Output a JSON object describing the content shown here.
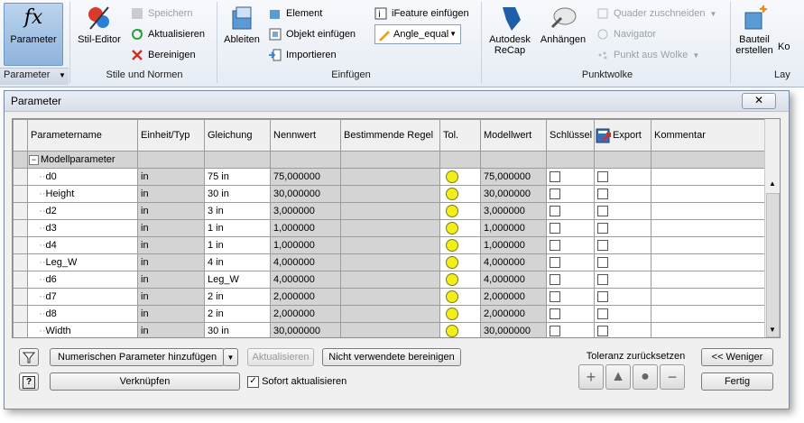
{
  "ribbon": {
    "panels": {
      "parameter": "Parameter",
      "stile": "Stile und Normen",
      "einfuegen": "Einfügen",
      "punktwolke": "Punktwolke",
      "layout": "Lay"
    },
    "buttons": {
      "parameter": "Parameter",
      "stil_editor": "Stil-Editor",
      "speichern": "Speichern",
      "aktualisieren": "Aktualisieren",
      "bereinigen": "Bereinigen",
      "ableiten": "Ableiten",
      "element": "Element",
      "objekt_einfuegen": "Objekt einfügen",
      "importieren": "Importieren",
      "ifeature_einfuegen": "iFeature einfügen",
      "angle_equal": "Angle_equal",
      "autodesk_recap_1": "Autodesk",
      "autodesk_recap_2": "ReCap",
      "anhaengen": "Anhängen",
      "quader_zuschneiden": "Quader zuschneiden",
      "navigator": "Navigator",
      "punkt_aus_wolke": "Punkt aus Wolke",
      "bauteil_erstellen_1": "Bauteil",
      "bauteil_erstellen_2": "erstellen",
      "ko": "Ko"
    }
  },
  "dialog": {
    "title": "Parameter",
    "close_label": "✕",
    "columns": [
      "Parametername",
      "Einheit/Typ",
      "Gleichung",
      "Nennwert",
      "Bestimmende Regel",
      "Tol.",
      "Modellwert",
      "Schlüssel",
      "Export",
      "Kommentar"
    ],
    "group": "Modellparameter",
    "group_toggle": "−",
    "rows": [
      {
        "name": "d0",
        "unit": "in",
        "equation": "75 in",
        "nominal": "75,000000",
        "model": "75,000000"
      },
      {
        "name": "Height",
        "unit": "in",
        "equation": "30 in",
        "nominal": "30,000000",
        "model": "30,000000"
      },
      {
        "name": "d2",
        "unit": "in",
        "equation": "3 in",
        "nominal": "3,000000",
        "model": "3,000000"
      },
      {
        "name": "d3",
        "unit": "in",
        "equation": "1 in",
        "nominal": "1,000000",
        "model": "1,000000"
      },
      {
        "name": "d4",
        "unit": "in",
        "equation": "1 in",
        "nominal": "1,000000",
        "model": "1,000000"
      },
      {
        "name": "Leg_W",
        "unit": "in",
        "equation": "4 in",
        "nominal": "4,000000",
        "model": "4,000000"
      },
      {
        "name": "d6",
        "unit": "in",
        "equation": "Leg_W",
        "nominal": "4,000000",
        "model": "4,000000"
      },
      {
        "name": "d7",
        "unit": "in",
        "equation": "2 in",
        "nominal": "2,000000",
        "model": "2,000000"
      },
      {
        "name": "d8",
        "unit": "in",
        "equation": "2 in",
        "nominal": "2,000000",
        "model": "2,000000"
      },
      {
        "name": "Width",
        "unit": "in",
        "equation": "30 in",
        "nominal": "30,000000",
        "model": "30,000000"
      }
    ],
    "buttons": {
      "add_numeric": "Numerischen Parameter hinzufügen",
      "update": "Aktualisieren",
      "purge_unused": "Nicht verwendete bereinigen",
      "link": "Verknüpfen",
      "immediate_update": "Sofort aktualisieren",
      "less": "<< Weniger",
      "done": "Fertig",
      "filter_icon": "funnel-icon",
      "help_icon": "help-icon"
    },
    "tolerance": {
      "label": "Toleranz zurücksetzen",
      "upper": "+",
      "nominal": "▲",
      "median": "●",
      "lower": "−"
    },
    "colors": {
      "tolerance_dot": "#f2ee1a",
      "readonly_cell": "#d4d4d4",
      "ribbon_active": "#8fb4dc"
    }
  }
}
